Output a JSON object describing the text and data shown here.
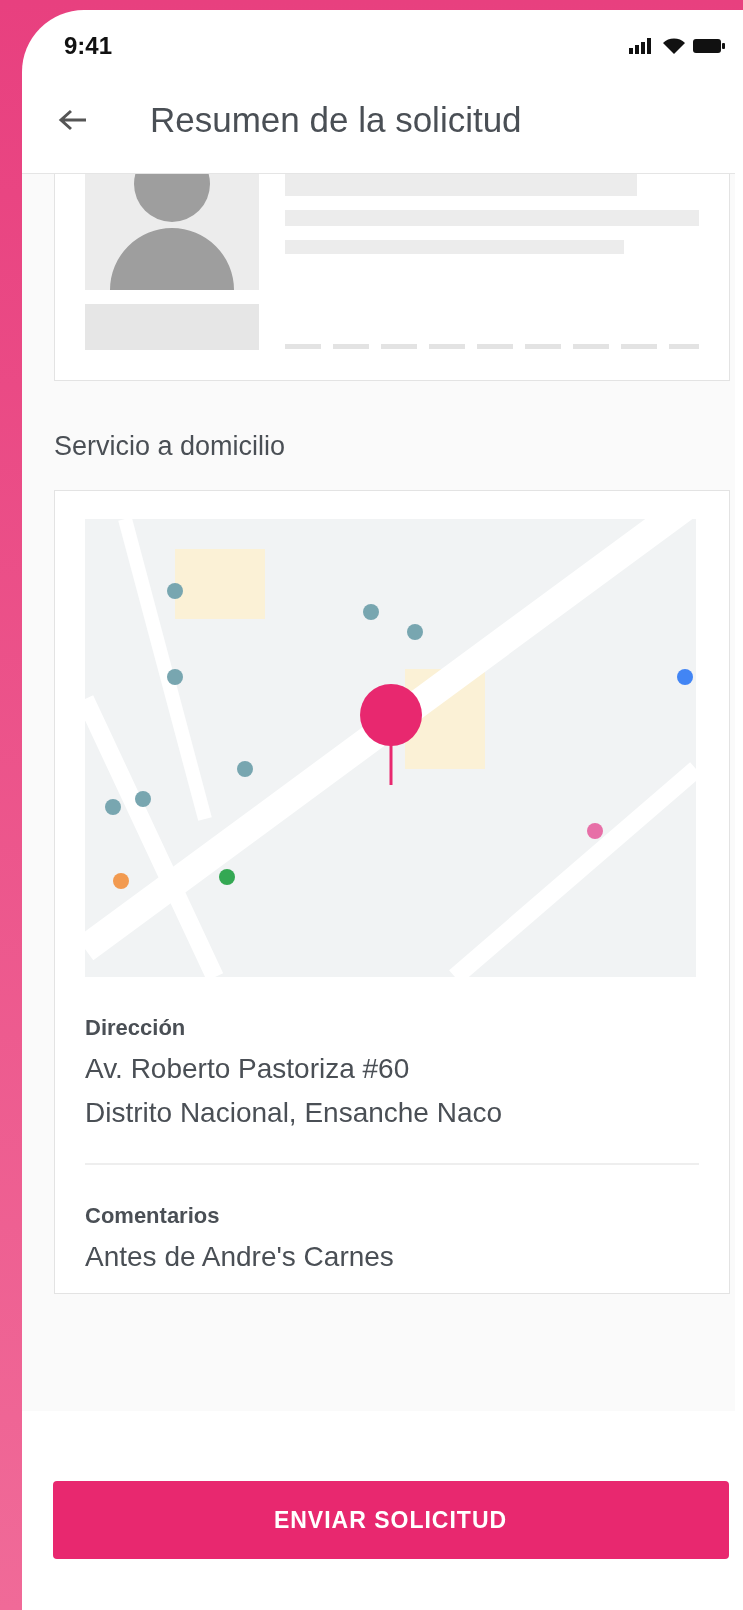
{
  "status_bar": {
    "time": "9:41"
  },
  "header": {
    "title": "Resumen de la solicitud"
  },
  "section_title": "Servicio a domicilio",
  "address": {
    "label": "Dirección",
    "lines": [
      "Av. Roberto Pastoriza #60",
      "Distrito Nacional, Ensanche Naco"
    ]
  },
  "comments": {
    "label": "Comentarios",
    "text": "Antes de Andre's Carnes"
  },
  "submit_button": "ENVIAR SOLICITUD"
}
